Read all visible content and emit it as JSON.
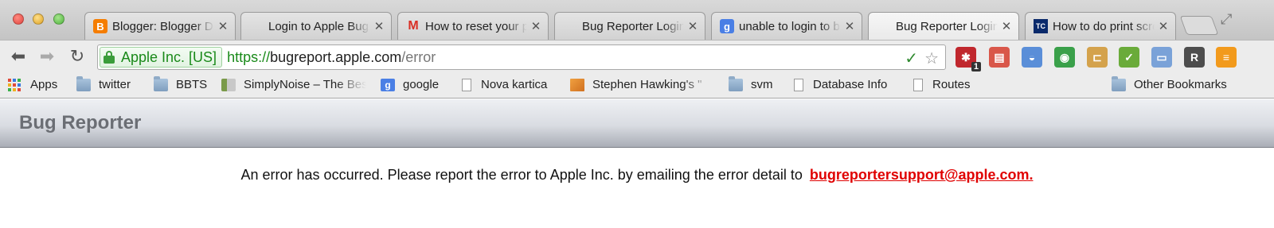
{
  "window": {
    "tabs": [
      {
        "label": "Blogger: Blogger Dashboard",
        "favicon": "blogger-icon",
        "color": "#f57d00",
        "glyph": "B"
      },
      {
        "label": "Login to Apple Bug Reporter",
        "favicon": "apple-icon",
        "color": "#666666",
        "glyph": ""
      },
      {
        "label": "How to reset your password",
        "favicon": "gmail-icon",
        "color": "#d93025",
        "glyph": "M"
      },
      {
        "label": "Bug Reporter Login",
        "favicon": "apple-icon",
        "color": "#666666",
        "glyph": ""
      },
      {
        "label": "unable to login to bug reporter",
        "favicon": "google-icon",
        "color": "#4a7fe5",
        "glyph": "g"
      },
      {
        "label": "Bug Reporter Login",
        "favicon": "apple-icon",
        "color": "#666666",
        "glyph": "",
        "active": true
      },
      {
        "label": "How to do print screen",
        "favicon": "techcrunch-icon",
        "color": "#0a2a6b",
        "glyph": "TC"
      }
    ],
    "close_glyph": "✕"
  },
  "toolbar": {
    "ev_label": "Apple Inc. [US]",
    "url_scheme": "https://",
    "url_host": "bugreport.apple.com",
    "url_path": "/error",
    "ext_badge": "1",
    "extensions": [
      {
        "name": "lastpass-icon",
        "color": "#c0272d",
        "glyph": "✱"
      },
      {
        "name": "pdf-icon",
        "color": "#d9574a",
        "glyph": "▤"
      },
      {
        "name": "screen-capture-icon",
        "color": "#5a8ed8",
        "glyph": "◒"
      },
      {
        "name": "android-icon",
        "color": "#3aa04a",
        "glyph": "◉"
      },
      {
        "name": "ruler-icon",
        "color": "#d4a24c",
        "glyph": "⊏"
      },
      {
        "name": "spellcheck-icon",
        "color": "#6aab3a",
        "glyph": "✓"
      },
      {
        "name": "window-icon",
        "color": "#7aa2d8",
        "glyph": "▭"
      },
      {
        "name": "readability-icon",
        "color": "#4d4d4d",
        "glyph": "R"
      },
      {
        "name": "menu-icon",
        "color": "#f29a1c",
        "glyph": "≡"
      }
    ]
  },
  "bookmarks": {
    "items": [
      {
        "label": "Apps",
        "type": "apps"
      },
      {
        "label": "twitter",
        "type": "folder"
      },
      {
        "label": "BBTS",
        "type": "folder"
      },
      {
        "label": "SimplyNoise – The Best",
        "type": "site"
      },
      {
        "label": "google",
        "type": "google"
      },
      {
        "label": "Nova kartica",
        "type": "page"
      },
      {
        "label": "Stephen Hawking's \"",
        "type": "image"
      },
      {
        "label": "svm",
        "type": "folder"
      },
      {
        "label": "Database Info",
        "type": "page"
      },
      {
        "label": "Routes",
        "type": "page"
      }
    ],
    "other": "Other Bookmarks"
  },
  "page": {
    "title": "Bug Reporter",
    "message": "An error has occurred. Please report the error to Apple Inc. by emailing the error detail to",
    "email": "bugreportersupport@apple.com."
  }
}
